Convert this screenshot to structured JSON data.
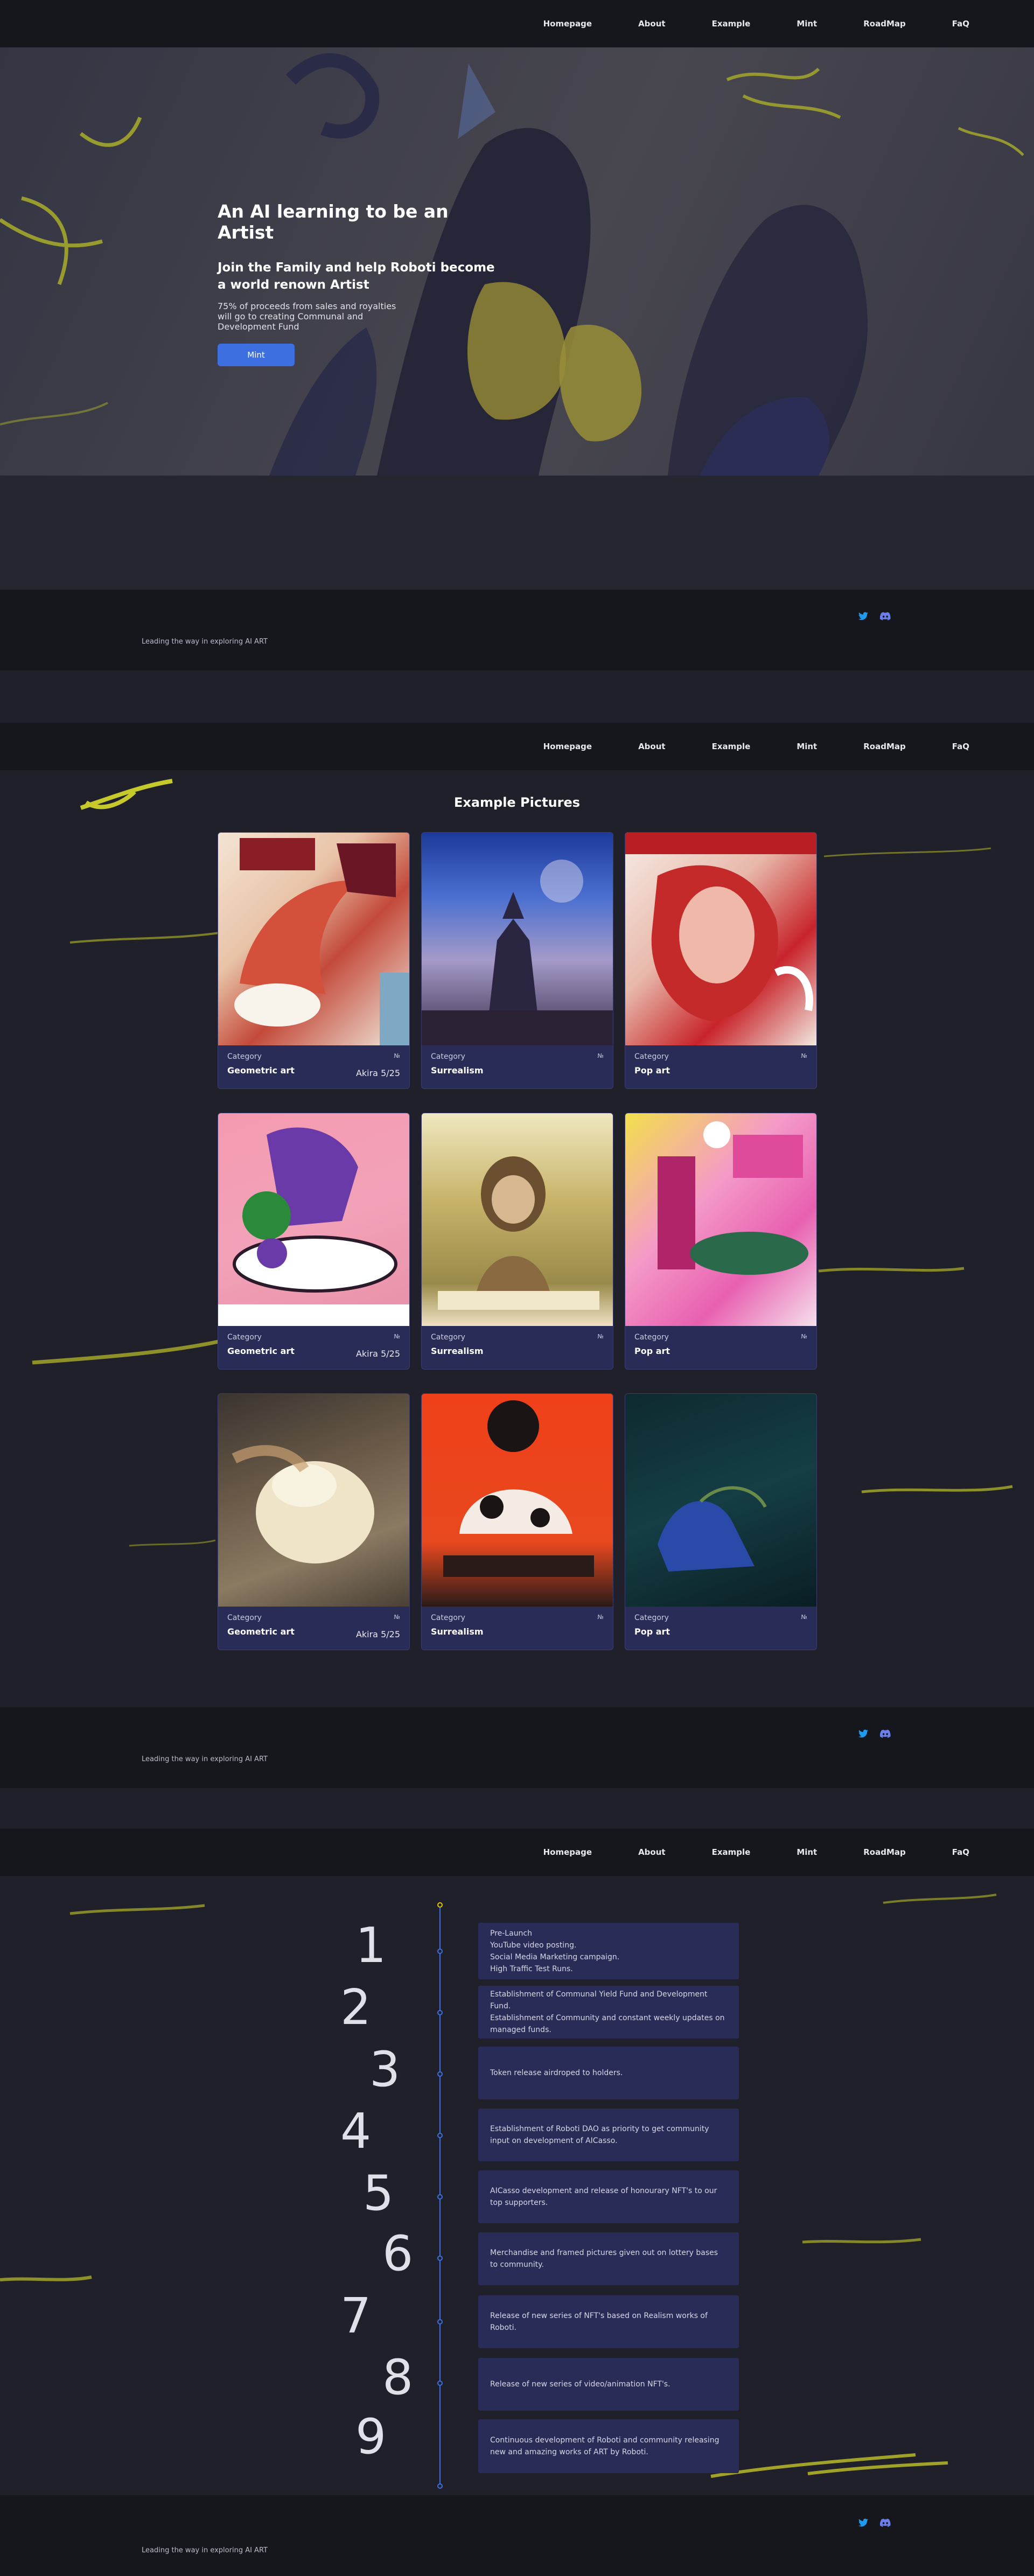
{
  "nav": {
    "items": [
      "Homepage",
      "About",
      "Example",
      "Mint",
      "RoadMap",
      "FaQ"
    ]
  },
  "hero": {
    "title": "An AI learning to be an Artist",
    "subtitle": "Join the Family and help Roboti become a world renown Artist",
    "description": "75% of proceeds from sales and royalties will go to creating Communal and Development Fund",
    "mint_button": "Mint"
  },
  "footer": {
    "tagline": "Leading the way in exploring AI ART",
    "socials": [
      "twitter-icon",
      "discord-icon"
    ]
  },
  "examples": {
    "title": "Example Pictures",
    "category_label": "Category",
    "no_label": "№",
    "cards": [
      {
        "category": "Geometric art",
        "edition": "Akira 5/25"
      },
      {
        "category": "Surrealism",
        "edition": ""
      },
      {
        "category": "Pop art",
        "edition": ""
      },
      {
        "category": "Geometric art",
        "edition": "Akira 5/25"
      },
      {
        "category": "Surrealism",
        "edition": ""
      },
      {
        "category": "Pop art",
        "edition": ""
      },
      {
        "category": "Geometric art",
        "edition": "Akira 5/25"
      },
      {
        "category": "Surrealism",
        "edition": ""
      },
      {
        "category": "Pop art",
        "edition": ""
      }
    ]
  },
  "roadmap": {
    "steps": [
      {
        "num": "1",
        "lines": [
          "Pre-Launch",
          "YouTube video posting.",
          "Social Media Marketing campaign.",
          "High Traffic Test Runs."
        ]
      },
      {
        "num": "2",
        "lines": [
          "Establishment of Communal Yield Fund and Development Fund.",
          "Establishment of Community and constant weekly updates on managed funds."
        ]
      },
      {
        "num": "3",
        "lines": [
          "Token release airdroped to holders."
        ]
      },
      {
        "num": "4",
        "lines": [
          "Establishment of Roboti DAO as priority to get community input on development of AICasso."
        ]
      },
      {
        "num": "5",
        "lines": [
          "AICasso development and release of honourary NFT's to our top supporters."
        ]
      },
      {
        "num": "6",
        "lines": [
          "Merchandise and framed pictures given out on lottery bases to community."
        ]
      },
      {
        "num": "7",
        "lines": [
          "Release of new series of NFT's based on Realism works of Roboti."
        ]
      },
      {
        "num": "8",
        "lines": [
          "Release of new series of video/animation NFT's."
        ]
      },
      {
        "num": "9",
        "lines": [
          "Continuous development of Roboti and community releasing new and amazing works of ART by Roboti."
        ]
      }
    ]
  },
  "colors": {
    "accent": "#3d6fe0",
    "card_bg": "#2a2c58",
    "page_bg": "#1f2029",
    "nav_bg": "#16171d",
    "brush_yellow": "#d8dc2a"
  }
}
